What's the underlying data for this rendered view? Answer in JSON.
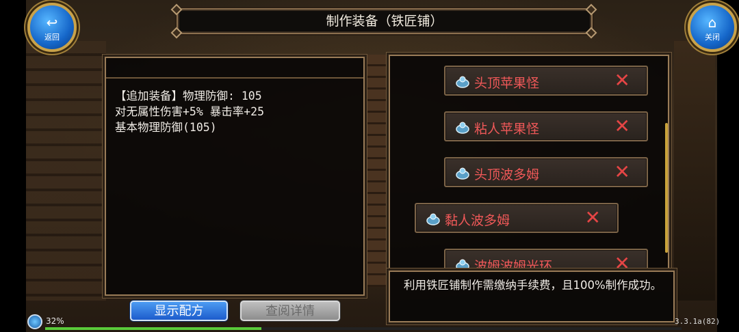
{
  "header": {
    "title": "制作装备（铁匠铺）"
  },
  "nav": {
    "back_label": "返回",
    "close_label": "关闭"
  },
  "description": {
    "lines": [
      "【追加装备】物理防御: 105",
      "对无属性伤害+5% 暴击率+25",
      "基本物理防御(105)"
    ]
  },
  "materials": [
    {
      "name": "头顶苹果怪",
      "icon": "material-icon",
      "remove_icon": "close-icon"
    },
    {
      "name": "粘人苹果怪",
      "icon": "material-icon",
      "remove_icon": "close-icon"
    },
    {
      "name": "头顶波多姆",
      "icon": "material-icon",
      "remove_icon": "close-icon"
    },
    {
      "name": "黏人波多姆",
      "icon": "material-icon",
      "remove_icon": "close-icon"
    },
    {
      "name": "波姆波姆光环",
      "icon": "material-icon",
      "remove_icon": "close-icon"
    }
  ],
  "notice": {
    "text": "利用铁匠铺制作需缴纳手续费，且100%制作成功。"
  },
  "buttons": {
    "show_recipe": "显示配方",
    "view_details": "查阅详情"
  },
  "status": {
    "battery": "32%",
    "version": "3.3.1a(82)",
    "progress_fraction": 0.34
  },
  "colors": {
    "material_name": "#ee5858",
    "remove": "#e54545",
    "primary_button": "#2f7ae0",
    "frame": "#9a7c58"
  }
}
